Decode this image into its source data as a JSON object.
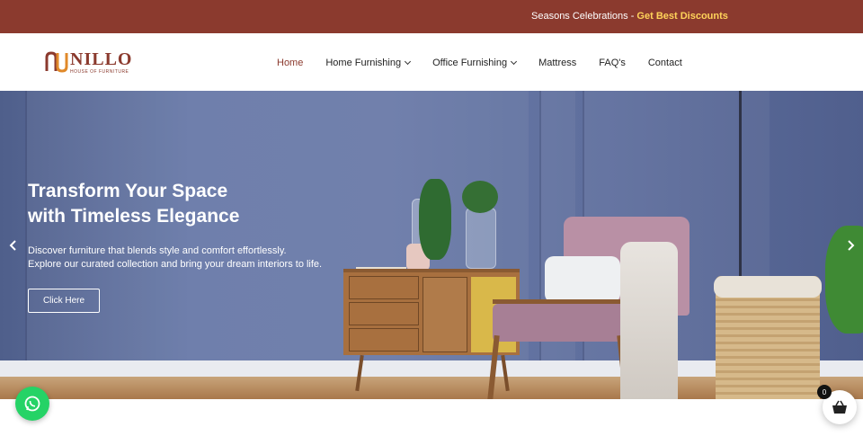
{
  "topbar": {
    "promo_text": "Seasons Celebrations",
    "promo_separator": "-",
    "promo_highlight": "Get Best Discounts",
    "background": "#8b3a2e",
    "highlight_color": "#ffd35a"
  },
  "logo": {
    "brand": "NILLO",
    "tagline": "HOUSE OF FURNITURE",
    "mark_icon": "nillo-logo-mark"
  },
  "nav": {
    "items": [
      {
        "label": "Home",
        "active": true,
        "has_dropdown": false
      },
      {
        "label": "Home Furnishing",
        "active": false,
        "has_dropdown": true
      },
      {
        "label": "Office Furnishing",
        "active": false,
        "has_dropdown": true
      },
      {
        "label": "Mattress",
        "active": false,
        "has_dropdown": false
      },
      {
        "label": "FAQ's",
        "active": false,
        "has_dropdown": false
      },
      {
        "label": "Contact",
        "active": false,
        "has_dropdown": false
      }
    ],
    "active_color": "#8b3a2e"
  },
  "hero": {
    "title_lines": [
      "Transform Your Space",
      "with Timeless Elegance"
    ],
    "subtitle_lines": [
      "Discover furniture that blends style and comfort effortlessly.",
      "Explore our curated collection and bring your dream interiors to life."
    ],
    "cta_label": "Click Here",
    "prev_icon": "chevron-left-icon",
    "next_icon": "chevron-right-icon"
  },
  "floating": {
    "whatsapp_icon": "whatsapp-icon",
    "cart_icon": "basket-icon",
    "cart_count": "0"
  }
}
